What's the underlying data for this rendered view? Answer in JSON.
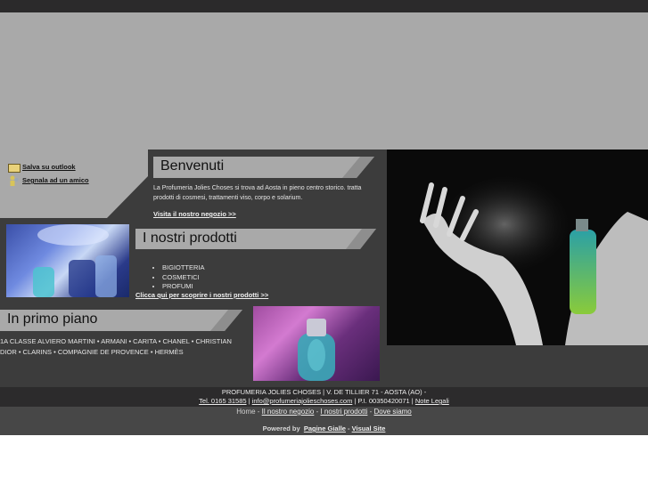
{
  "sidebar": {
    "save_outlook": "Salva su outlook",
    "tell_friend": "Segnala ad un amico"
  },
  "welcome": {
    "title": "Benvenuti",
    "body": "La Profumeria Jolies Choses si trova ad Aosta in pieno centro storico. tratta prodotti di cosmesi, trattamenti viso, corpo e solarium.",
    "link": "Visita il nostro negozio >>"
  },
  "products": {
    "title": "I nostri prodotti",
    "items": [
      "BIGIOTTERIA",
      "COSMETICI",
      "PROFUMI"
    ],
    "link": "Clicca qui per scoprire i nostri prodotti >>"
  },
  "featured": {
    "title": "In primo piano",
    "brands": "1A CLASSE ALVIERO MARTINI • ARMANI • CARITA • CHANEL • CHRISTIAN DIOR • CLARINS • COMPAGNIE DE PROVENCE • HERMÈS"
  },
  "footer": {
    "address": "PROFUMERIA JOLIES CHOSES | V. DE TILLIER 71 - AOSTA (AO) -",
    "phone": "Tel. 0165 31585",
    "sep1": " | ",
    "email": "info@profumeriajolieschoses.com",
    "vat": " | P.I. 00350420071 | ",
    "legal": "Note Legali",
    "nav": {
      "home": "Home",
      "sep": " - ",
      "shop": "Il nostro negozio",
      "products": "I nostri prodotti",
      "where": "Dove siamo"
    },
    "powered_label": "Powered by",
    "pagine_gialle": "Pagine Gialle",
    "dash": " - ",
    "visual_site": "Visual Site"
  }
}
